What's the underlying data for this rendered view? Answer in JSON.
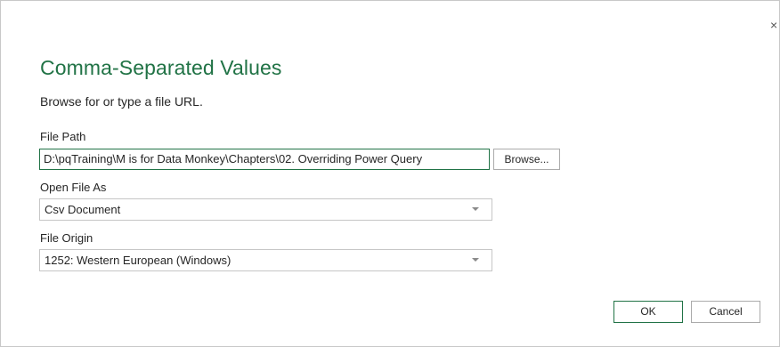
{
  "dialog": {
    "close_glyph": "×",
    "title": "Comma-Separated Values",
    "subtitle": "Browse for or type a file URL."
  },
  "file_path": {
    "label": "File Path",
    "value": "D:\\pqTraining\\M is for Data Monkey\\Chapters\\02. Overriding Power Query",
    "browse_label": "Browse..."
  },
  "open_file_as": {
    "label": "Open File As",
    "selected": "Csv Document"
  },
  "file_origin": {
    "label": "File Origin",
    "selected": "1252: Western European (Windows)"
  },
  "buttons": {
    "ok": "OK",
    "cancel": "Cancel"
  },
  "colors": {
    "accent": "#217346",
    "border": "#c6c6c6",
    "text": "#262626"
  }
}
